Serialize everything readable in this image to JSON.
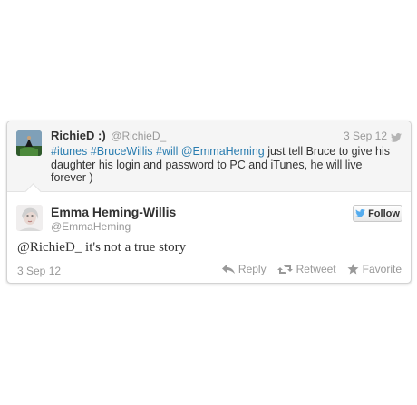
{
  "parent_tweet": {
    "name": "RichieD :)",
    "handle": "@RichieD_",
    "date": "3 Sep 12",
    "text_parts": {
      "tag1": "#itunes",
      "tag2": "#BruceWillis",
      "tag3": "#will",
      "mention": "@EmmaHeming",
      "rest": " just tell Bruce to give his daughter his login and password to PC and iTunes, he will live forever )"
    },
    "avatar_icon": "avatar-photo"
  },
  "reply_tweet": {
    "name": "Emma Heming-Willis",
    "handle": "@EmmaHeming",
    "follow_label": "Follow",
    "text": "@RichieD_  it's not a true story",
    "date": "3 Sep 12",
    "avatar_icon": "avatar-photo"
  },
  "actions": {
    "reply_label": "Reply",
    "retweet_label": "Retweet",
    "favorite_label": "Favorite"
  },
  "colors": {
    "link": "#2a7db0",
    "muted": "#999999",
    "text": "#333333",
    "bird": "#55acee"
  }
}
